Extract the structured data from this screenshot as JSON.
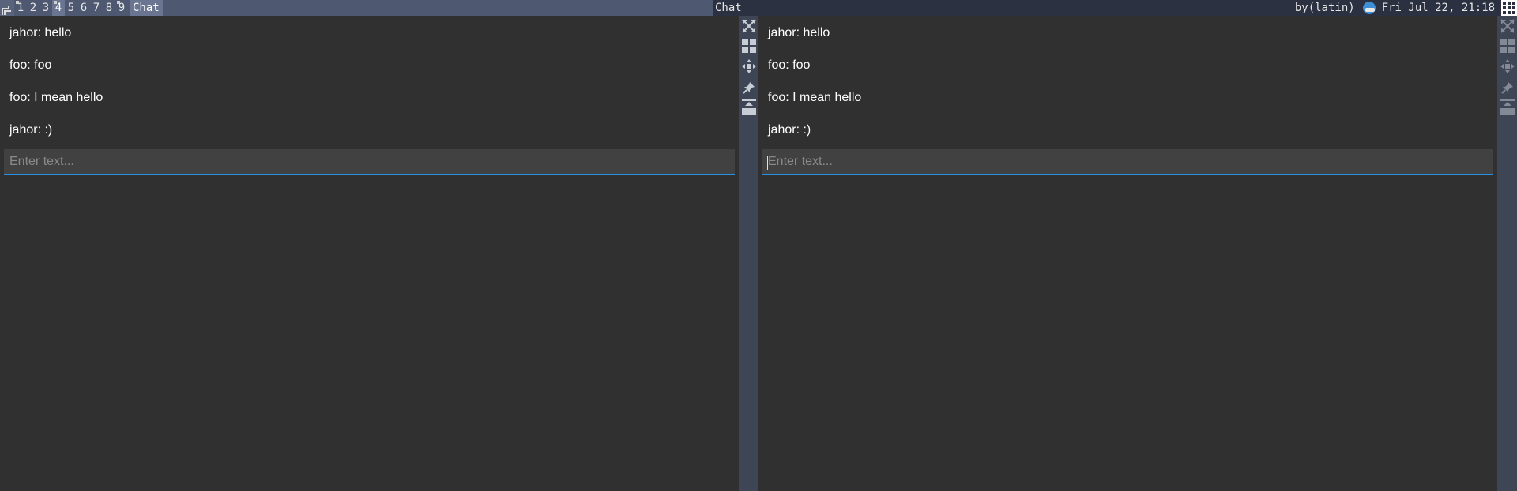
{
  "topbar": {
    "tags": [
      "1",
      "2",
      "3",
      "4",
      "5",
      "6",
      "7",
      "8",
      "9"
    ],
    "active_tag": "4",
    "focused_title": "Chat",
    "center_title": "Chat",
    "keyboard_layout": "by(latin)",
    "clock": "Fri Jul 22, 21:18"
  },
  "left_pane": {
    "messages": [
      "jahor: hello",
      "foo: foo",
      "foo: I mean hello",
      "jahor: :)"
    ],
    "input_placeholder": "Enter text..."
  },
  "right_pane": {
    "messages": [
      "jahor: hello",
      "foo: foo",
      "foo: I mean hello",
      "jahor: :)"
    ],
    "input_placeholder": "Enter text..."
  },
  "icons": {
    "launcher": "launcher-icon",
    "tray": "network-tray-icon",
    "layout": "layout-grid-icon",
    "window_buttons": [
      "maximize-icon",
      "tile-icon",
      "move-icon",
      "pin-icon",
      "minimize-to-top-icon"
    ]
  },
  "colors": {
    "accent": "#2a8fe0",
    "bar_left": "#4e5870",
    "bar": "#2b3140",
    "background": "#303030",
    "input": "#414141"
  }
}
